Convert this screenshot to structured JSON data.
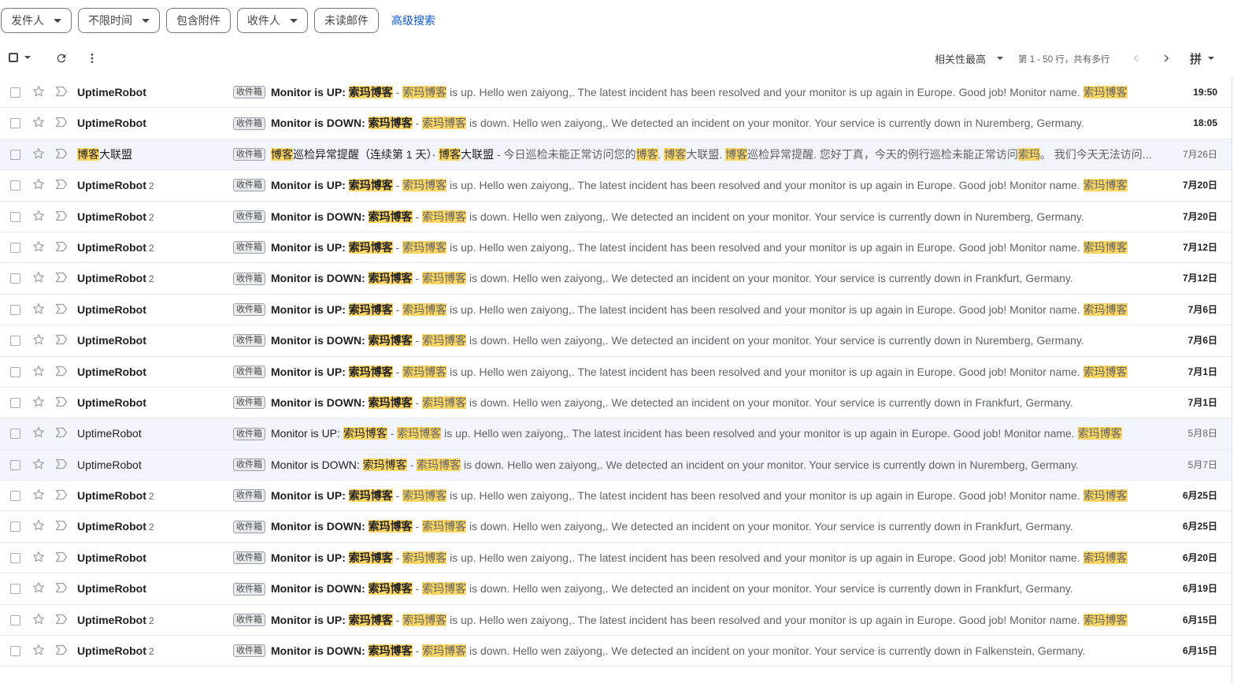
{
  "filters": {
    "sender": "发件人",
    "time": "不限时间",
    "attachment": "包含附件",
    "recipient": "收件人",
    "unread": "未读邮件",
    "advanced": "高级搜索"
  },
  "toolbar": {
    "sort": "相关性最高",
    "range": "第 1 - 50 行，共有多行",
    "input_method": "拼"
  },
  "label": "收件箱",
  "highlight_color": "#fdd663",
  "emails": [
    {
      "sender": "UptimeRobot",
      "count": "",
      "unread": true,
      "subj_pre": "Monitor is UP: ",
      "subj_hl": "索玛博客",
      "sep": " - ",
      "snip_hl": "索玛博客",
      "snip_text": " is up. Hello wen zaiyong,. The latest incident has been resolved and your monitor is up again in Europe. Good job! Monitor name. ",
      "snip_tail_hl": "索玛博客",
      "date": "19:50"
    },
    {
      "sender": "UptimeRobot",
      "count": "",
      "unread": true,
      "subj_pre": "Monitor is DOWN: ",
      "subj_hl": "索玛博客",
      "sep": " - ",
      "snip_hl": "索玛博客",
      "snip_text": " is down. Hello wen zaiyong,. We detected an incident on your monitor. Your service is currently down in Nuremberg, Germany.",
      "snip_tail_hl": "",
      "date": "18:05"
    },
    {
      "sender_hl": "博客",
      "sender_rest": "大联盟",
      "count": "",
      "unread": false,
      "special": true,
      "date": "7月26日"
    },
    {
      "sender": "UptimeRobot",
      "count": "2",
      "unread": true,
      "subj_pre": "Monitor is UP: ",
      "subj_hl": "索玛博客",
      "sep": " - ",
      "snip_hl": "索玛博客",
      "snip_text": " is up. Hello wen zaiyong,. The latest incident has been resolved and your monitor is up again in Europe. Good job! Monitor name. ",
      "snip_tail_hl": "索玛博客",
      "date": "7月20日"
    },
    {
      "sender": "UptimeRobot",
      "count": "2",
      "unread": true,
      "subj_pre": "Monitor is DOWN: ",
      "subj_hl": "索玛博客",
      "sep": " - ",
      "snip_hl": "索玛博客",
      "snip_text": " is down. Hello wen zaiyong,. We detected an incident on your monitor. Your service is currently down in Nuremberg, Germany.",
      "snip_tail_hl": "",
      "date": "7月20日"
    },
    {
      "sender": "UptimeRobot",
      "count": "2",
      "unread": true,
      "subj_pre": "Monitor is UP: ",
      "subj_hl": "索玛博客",
      "sep": " - ",
      "snip_hl": "索玛博客",
      "snip_text": " is up. Hello wen zaiyong,. The latest incident has been resolved and your monitor is up again in Europe. Good job! Monitor name. ",
      "snip_tail_hl": "索玛博客",
      "date": "7月12日"
    },
    {
      "sender": "UptimeRobot",
      "count": "2",
      "unread": true,
      "subj_pre": "Monitor is DOWN: ",
      "subj_hl": "索玛博客",
      "sep": " - ",
      "snip_hl": "索玛博客",
      "snip_text": " is down. Hello wen zaiyong,. We detected an incident on your monitor. Your service is currently down in Frankfurt, Germany.",
      "snip_tail_hl": "",
      "date": "7月12日"
    },
    {
      "sender": "UptimeRobot",
      "count": "",
      "unread": true,
      "subj_pre": "Monitor is UP: ",
      "subj_hl": "索玛博客",
      "sep": " - ",
      "snip_hl": "索玛博客",
      "snip_text": " is up. Hello wen zaiyong,. The latest incident has been resolved and your monitor is up again in Europe. Good job! Monitor name. ",
      "snip_tail_hl": "索玛博客",
      "date": "7月6日"
    },
    {
      "sender": "UptimeRobot",
      "count": "",
      "unread": true,
      "subj_pre": "Monitor is DOWN: ",
      "subj_hl": "索玛博客",
      "sep": " - ",
      "snip_hl": "索玛博客",
      "snip_text": " is down. Hello wen zaiyong,. We detected an incident on your monitor. Your service is currently down in Nuremberg, Germany.",
      "snip_tail_hl": "",
      "date": "7月6日"
    },
    {
      "sender": "UptimeRobot",
      "count": "",
      "unread": true,
      "subj_pre": "Monitor is UP: ",
      "subj_hl": "索玛博客",
      "sep": " - ",
      "snip_hl": "索玛博客",
      "snip_text": " is up. Hello wen zaiyong,. The latest incident has been resolved and your monitor is up again in Europe. Good job! Monitor name. ",
      "snip_tail_hl": "索玛博客",
      "date": "7月1日"
    },
    {
      "sender": "UptimeRobot",
      "count": "",
      "unread": true,
      "subj_pre": "Monitor is DOWN: ",
      "subj_hl": "索玛博客",
      "sep": " - ",
      "snip_hl": "索玛博客",
      "snip_text": " is down. Hello wen zaiyong,. We detected an incident on your monitor. Your service is currently down in Frankfurt, Germany.",
      "snip_tail_hl": "",
      "date": "7月1日"
    },
    {
      "sender": "UptimeRobot",
      "count": "",
      "unread": false,
      "subj_pre": "Monitor is UP: ",
      "subj_hl": "索玛博客",
      "sep": " - ",
      "snip_hl": "索玛博客",
      "snip_text": " is up. Hello wen zaiyong,. The latest incident has been resolved and your monitor is up again in Europe. Good job! Monitor name. ",
      "snip_tail_hl": "索玛博客",
      "date": "5月8日"
    },
    {
      "sender": "UptimeRobot",
      "count": "",
      "unread": false,
      "subj_pre": "Monitor is DOWN: ",
      "subj_hl": "索玛博客",
      "sep": " - ",
      "snip_hl": "索玛博客",
      "snip_text": " is down. Hello wen zaiyong,. We detected an incident on your monitor. Your service is currently down in Nuremberg, Germany.",
      "snip_tail_hl": "",
      "date": "5月7日"
    },
    {
      "sender": "UptimeRobot",
      "count": "2",
      "unread": true,
      "subj_pre": "Monitor is UP: ",
      "subj_hl": "索玛博客",
      "sep": " - ",
      "snip_hl": "索玛博客",
      "snip_text": " is up. Hello wen zaiyong,. The latest incident has been resolved and your monitor is up again in Europe. Good job! Monitor name. ",
      "snip_tail_hl": "索玛博客",
      "date": "6月25日"
    },
    {
      "sender": "UptimeRobot",
      "count": "2",
      "unread": true,
      "subj_pre": "Monitor is DOWN: ",
      "subj_hl": "索玛博客",
      "sep": " - ",
      "snip_hl": "索玛博客",
      "snip_text": " is down. Hello wen zaiyong,. We detected an incident on your monitor. Your service is currently down in Frankfurt, Germany.",
      "snip_tail_hl": "",
      "date": "6月25日"
    },
    {
      "sender": "UptimeRobot",
      "count": "",
      "unread": true,
      "subj_pre": "Monitor is UP: ",
      "subj_hl": "索玛博客",
      "sep": " - ",
      "snip_hl": "索玛博客",
      "snip_text": " is up. Hello wen zaiyong,. The latest incident has been resolved and your monitor is up again in Europe. Good job! Monitor name. ",
      "snip_tail_hl": "索玛博客",
      "date": "6月20日"
    },
    {
      "sender": "UptimeRobot",
      "count": "",
      "unread": true,
      "subj_pre": "Monitor is DOWN: ",
      "subj_hl": "索玛博客",
      "sep": " - ",
      "snip_hl": "索玛博客",
      "snip_text": " is down. Hello wen zaiyong,. We detected an incident on your monitor. Your service is currently down in Frankfurt, Germany.",
      "snip_tail_hl": "",
      "date": "6月19日"
    },
    {
      "sender": "UptimeRobot",
      "count": "2",
      "unread": true,
      "subj_pre": "Monitor is UP: ",
      "subj_hl": "索玛博客",
      "sep": " - ",
      "snip_hl": "索玛博客",
      "snip_text": " is up. Hello wen zaiyong,. The latest incident has been resolved and your monitor is up again in Europe. Good job! Monitor name. ",
      "snip_tail_hl": "索玛博客",
      "date": "6月15日"
    },
    {
      "sender": "UptimeRobot",
      "count": "2",
      "unread": true,
      "subj_pre": "Monitor is DOWN: ",
      "subj_hl": "索玛博客",
      "sep": " - ",
      "snip_hl": "索玛博客",
      "snip_text": " is down. Hello wen zaiyong,. We detected an incident on your monitor. Your service is currently down in Falkenstein, Germany.",
      "snip_tail_hl": "",
      "date": "6月15日"
    }
  ],
  "special_row": {
    "subj_hl1": "博客",
    "subj_text": "巡检异常提醒（连续第 1 天）· ",
    "subj_hl2": "博客",
    "subj_text2": "大联盟",
    "snip_a": " - 今日巡检未能正常访问您的",
    "snip_hl_a": "博客",
    "snip_b": ". ",
    "snip_hl_b": "博客",
    "snip_c": "大联盟. ",
    "snip_hl_c": "博客",
    "snip_d": "巡检异常提醒. 您好丁真，今天的例行巡检未能正常访问",
    "snip_hl_d": "索玛",
    "snip_e": "。 我们今天无法访问..."
  }
}
